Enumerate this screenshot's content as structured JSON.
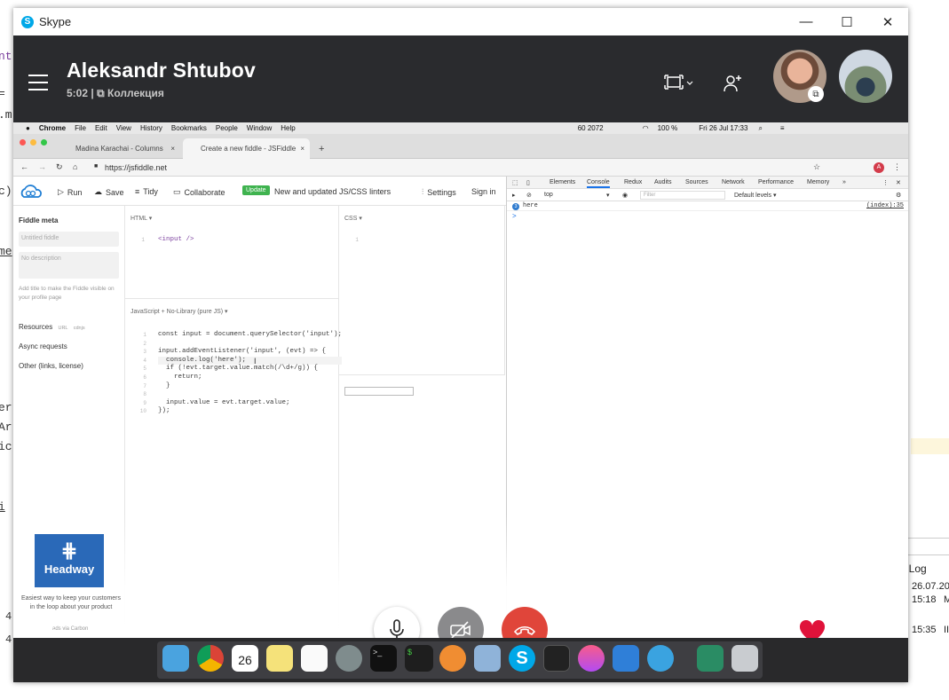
{
  "background_left_fragments": [
    "nt",
    "=",
    ".m",
    "c)",
    "me",
    "er",
    "Ar",
    "ic",
    "i",
    "4",
    "4"
  ],
  "background_right": {
    "header": "t Log",
    "rows": [
      {
        "date": "26.07.20",
        "time": "15:18",
        "suffix": "M"
      },
      {
        "date": "",
        "time": "15:35",
        "suffix": "II"
      }
    ]
  },
  "window": {
    "app_name": "Skype",
    "minimize_glyph": "—",
    "maximize_glyph": "☐",
    "close_glyph": "✕"
  },
  "call": {
    "contact_name": "Aleksandr Shtubov",
    "duration": "5:02",
    "separator": "|",
    "collection_label": "Коллекция",
    "colors": {
      "header_bg": "#2a2b2e",
      "end_call": "#e0453a",
      "heart": "#e0123a"
    }
  },
  "mac_menubar": {
    "app": "Chrome",
    "menus": [
      "File",
      "Edit",
      "View",
      "History",
      "Bookmarks",
      "People",
      "Window",
      "Help"
    ],
    "status": "60 2072",
    "battery": "100 %",
    "clock": "Fri 26 Jul  17:33"
  },
  "browser": {
    "tabs": [
      {
        "title": "Madina Karachai - Columns",
        "close": "×"
      },
      {
        "title": "Create a new fiddle - JSFiddle",
        "close": "×"
      }
    ],
    "new_tab": "+",
    "url": "https://jsfiddle.net",
    "profile_letter": "A"
  },
  "jsfiddle": {
    "toolbar": {
      "run": "Run",
      "save": "Save",
      "tidy": "Tidy",
      "collaborate": "Collaborate",
      "update_badge": "Update",
      "update_text": "New and updated JS/CSS linters",
      "settings": "Settings",
      "sign_in": "Sign in"
    },
    "sidebar": {
      "title": "Fiddle meta",
      "title_placeholder": "Untitled fiddle",
      "desc_placeholder": "No description",
      "hint": "Add title to make the Fiddle visible on your profile page",
      "resources": "Resources",
      "url_tag": "URL",
      "cdnjs_tag": "cdnjs",
      "async": "Async requests",
      "other": "Other (links, license)",
      "ad_brand": "Headway",
      "ad_text": "Easiest way to keep your customers in the loop about your product",
      "ad_via": "ads via Carbon"
    },
    "html_label": "HTML ▾",
    "css_label": "CSS ▾",
    "js_label": "JavaScript + No-Library (pure JS) ▾",
    "html_code": [
      "<input />"
    ],
    "css_line_number": "1",
    "js_code": [
      "const input = document.querySelector('input');",
      "",
      "input.addEventListener('input', (evt) => {",
      "  console.log('here');",
      "  if (!evt.target.value.match(/\\d+/g)) {",
      "    return;",
      "  }",
      "",
      "  input.value = evt.target.value;",
      "});"
    ]
  },
  "devtools": {
    "tabs": [
      "Elements",
      "Console",
      "Redux",
      "Audits",
      "Sources",
      "Network",
      "Performance",
      "Memory",
      "»"
    ],
    "active_tab": "Console",
    "context": "top",
    "filter_placeholder": "Filter",
    "levels": "Default levels ▾",
    "log": {
      "count": "3",
      "message": "here",
      "source": "(index):35"
    },
    "prompt": ">"
  }
}
